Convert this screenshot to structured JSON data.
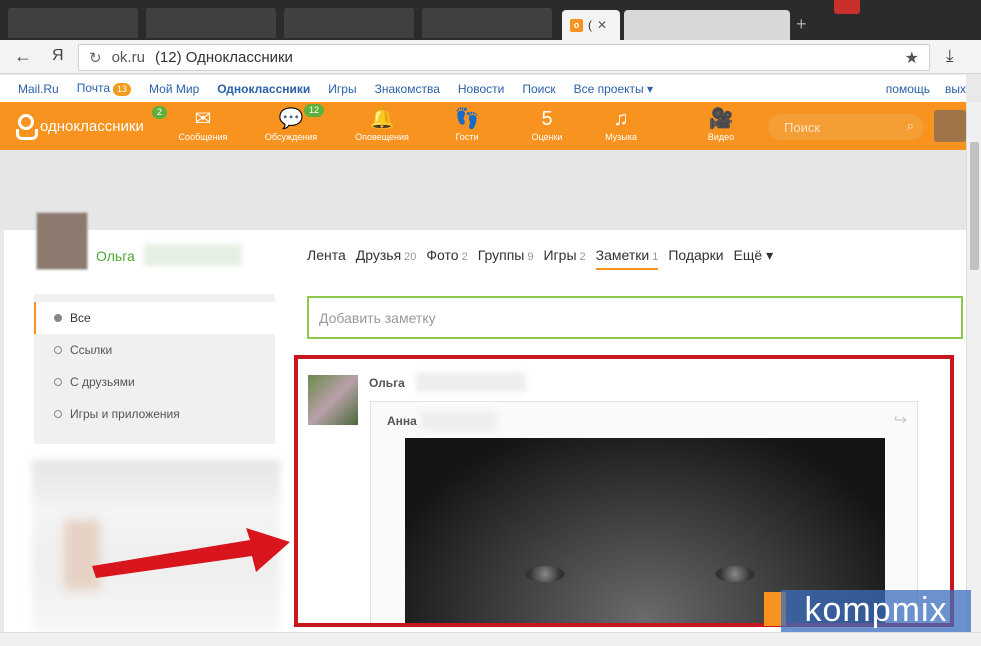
{
  "browser": {
    "active_tab_label": "(",
    "tab_favicon": "ok",
    "url_domain": "ok.ru",
    "page_title": "(12) Одноклассники",
    "ya_label": "Я"
  },
  "portal": {
    "links": [
      {
        "label": "Mail.Ru"
      },
      {
        "label": "Почта",
        "badge": "13"
      },
      {
        "label": "Мой Мир"
      },
      {
        "label": "Одноклассники",
        "bold": true
      },
      {
        "label": "Игры"
      },
      {
        "label": "Знакомства"
      },
      {
        "label": "Новости"
      },
      {
        "label": "Поиск"
      },
      {
        "label": "Все проекты ▾"
      }
    ],
    "help": "помощь",
    "exit": "вых"
  },
  "header": {
    "logo": "одноклассники",
    "logo_badge": "2",
    "nav": [
      {
        "label": "Сообщения",
        "icon": "envelope-icon",
        "glyph": "✉"
      },
      {
        "label": "Обсуждения",
        "icon": "chat-icon",
        "glyph": "💬",
        "badge": "12"
      },
      {
        "label": "Оповещения",
        "icon": "bell-icon",
        "glyph": "🔔"
      },
      {
        "label": "Гости",
        "icon": "footprints-icon",
        "glyph": "👣"
      },
      {
        "label": "Оценки",
        "icon": "rating-icon",
        "glyph": "5"
      },
      {
        "label": "Музыка",
        "icon": "music-icon",
        "glyph": "♫"
      },
      {
        "label": "Видео",
        "icon": "video-camera-icon",
        "glyph": "🎥"
      }
    ],
    "search_placeholder": "Поиск"
  },
  "profile": {
    "name": "Ольга",
    "tabs": [
      {
        "label": "Лента",
        "count": ""
      },
      {
        "label": "Друзья",
        "count": "20"
      },
      {
        "label": "Фото",
        "count": "2"
      },
      {
        "label": "Группы",
        "count": "9"
      },
      {
        "label": "Игры",
        "count": "2"
      },
      {
        "label": "Заметки",
        "count": "1",
        "active": true
      },
      {
        "label": "Подарки",
        "count": ""
      },
      {
        "label": "Ещё ▾",
        "count": ""
      }
    ]
  },
  "sidemenu": {
    "items": [
      {
        "label": "Все",
        "active": true
      },
      {
        "label": "Ссылки"
      },
      {
        "label": "С друзьями"
      },
      {
        "label": "Игры и приложения"
      }
    ]
  },
  "notes": {
    "add_placeholder": "Добавить заметку",
    "post_author": "Ольга",
    "shared_author": "Анна"
  },
  "watermark": "kompmix",
  "colors": {
    "ok_orange": "#f7931e",
    "highlight_red": "#c8161d",
    "input_green": "#8cc84b",
    "name_green": "#4ea732"
  }
}
